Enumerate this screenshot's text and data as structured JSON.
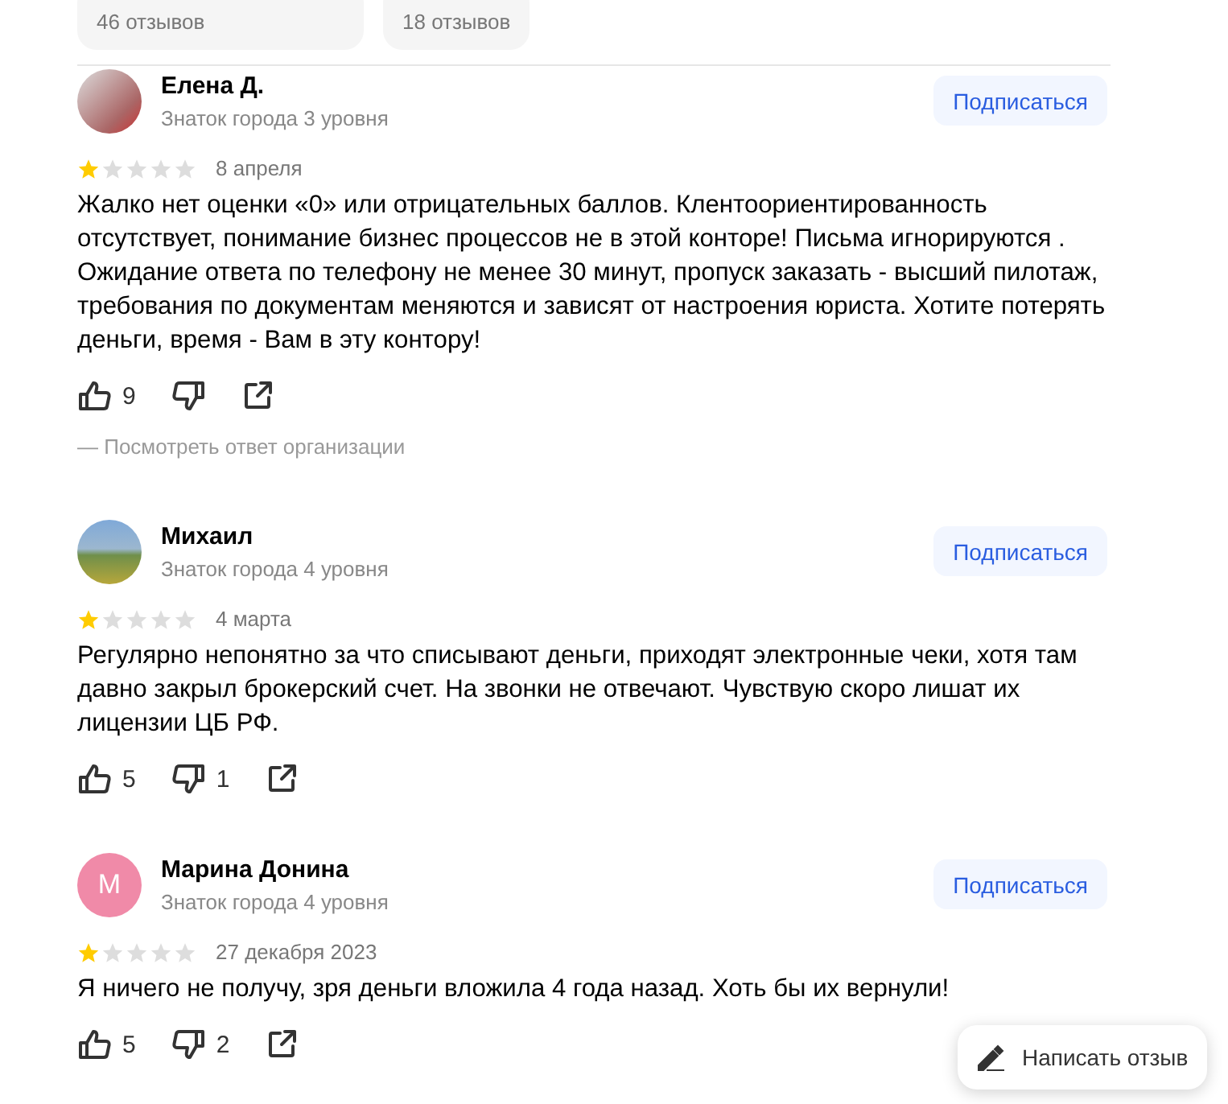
{
  "rating_cards": [
    {
      "count": "46 отзывов"
    },
    {
      "count": "18 отзывов"
    }
  ],
  "reviews": [
    {
      "author": "Елена Д.",
      "avatar": {
        "kind": "photo"
      },
      "badge": "Знаток города 3 уровня",
      "subscribe": "Подписаться",
      "stars": 1,
      "date": "8 апреля",
      "text": "Жалко нет оценки «0» или отрицательных баллов. Клентоориентированность отсутствует, понимание бизнес процессов не в этой конторе! Письма игнорируются . Ожидание ответа по телефону не менее 30 минут, пропуск заказать - высший пилотаж, требования по документам меняются и зависят от настроения юриста. Хотите потерять деньги, время - Вам в эту контору!",
      "likes": "9",
      "reply_link": "— Посмотреть ответ организации"
    },
    {
      "author": "Михаил",
      "avatar": {
        "kind": "photo"
      },
      "badge": "Знаток города 4 уровня",
      "subscribe": "Подписаться",
      "stars": 1,
      "date": "4 марта",
      "text": "Регулярно непонятно за что списывают деньги, приходят электронные чеки, хотя там давно закрыл брокерский счет. На звонки не отвечают. Чувствую скоро лишат их лицензии ЦБ РФ.",
      "likes": "5",
      "dislikes": "1"
    },
    {
      "author": "Марина Донина",
      "avatar": {
        "kind": "letter",
        "letter": "М",
        "color": "#f08aa8"
      },
      "badge": "Знаток города 4 уровня",
      "subscribe": "Подписаться",
      "stars": 1,
      "date": "27 декабря 2023",
      "text": "Я ничего не получу, зря деньги вложила 4 года назад. Хоть бы их вернули!",
      "likes": "5",
      "dislikes": "2"
    }
  ],
  "write_review_button": "Написать отзыв"
}
